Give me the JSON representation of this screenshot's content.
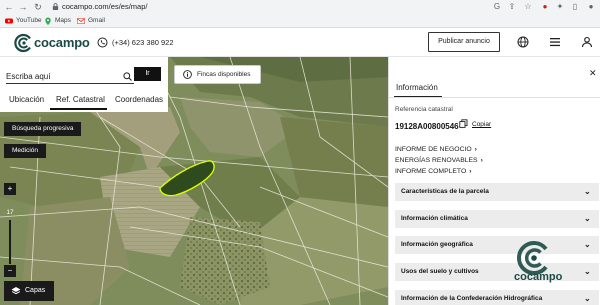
{
  "browser": {
    "url": "cocampo.com/es/es/map/",
    "bookmarks": [
      {
        "label": "YouTube",
        "icon": "youtube-icon"
      },
      {
        "label": "Maps",
        "icon": "maps-icon"
      },
      {
        "label": "Gmail",
        "icon": "gmail-icon"
      }
    ]
  },
  "header": {
    "logo_text": "cocampo",
    "phone": "(+34) 623 380 922",
    "publish_label": "Publicar anuncio",
    "accent": "#1b4a45"
  },
  "search": {
    "placeholder": "Escriba aquí",
    "go_label": "Ir",
    "tabs": [
      "Ubicación",
      "Ref. Catastral",
      "Coordenadas"
    ],
    "active_tab": "Ref. Catastral"
  },
  "map": {
    "fincas_label": "Fincas disponibles",
    "busqueda_label": "Búsqueda progresiva",
    "medicion_label": "Medición",
    "zoom_in": "+",
    "zoom_level": "17",
    "zoom_out": "−",
    "capas_label": "Capas",
    "highlight_color": "#d8ff00"
  },
  "panel": {
    "title": "Información",
    "close": "✕",
    "ref_label": "Referencia catastral",
    "ref_value": "19128A00800546",
    "copy_label": "Copiar",
    "links": [
      "INFORME DE NEGOCIO",
      "ENERGÍAS RENOVABLES",
      "INFORME COMPLETO"
    ],
    "sections": [
      "Características de la parcela",
      "Información climática",
      "Información geográfica",
      "Usos del suelo y cultivos",
      "Información de la Confederación Hidrográfica"
    ],
    "watermark_text": "cocampo"
  }
}
